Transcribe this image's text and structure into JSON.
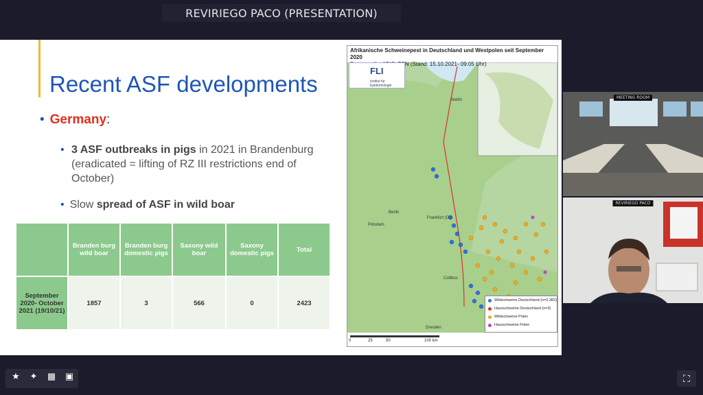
{
  "window": {
    "title": "REVIRIEGO PACO (PRESENTATION)"
  },
  "slide": {
    "title": "Recent ASF developments",
    "bullet1_label": "Germany",
    "bullet1_colon": ":",
    "bullet2_bold": "3 ASF outbreaks in pigs",
    "bullet2_rest": " in 2021 in Brandenburg (eradicated = lifting of RZ III restrictions end of October)",
    "bullet3_pre": "Slow ",
    "bullet3_bold": "spread of ASF in wild boar",
    "table": {
      "headers": [
        "",
        "Branden burg wild boar",
        "Branden burg domestic pigs",
        "Saxony wild boar",
        "Saxony domestic pigs",
        "Total"
      ],
      "row": [
        "September 2020- October 2021 (19/10/21)",
        "1857",
        "3",
        "566",
        "0",
        "2423"
      ]
    },
    "map": {
      "title_line1": "Afrikanische Schweinepest in Deutschland und Westpolen seit September 2020",
      "title_line2": "Datenquelle: ADIS, TSN (Stand: 15.10.2021- 09:05 Uhr)",
      "logo": "FLI",
      "logo_sub": "Institut für Epidemiologie",
      "cities": [
        "Stettin",
        "Berlin",
        "Potsdam",
        "Frankfurt (O.)",
        "Cottbus",
        "Dresden"
      ],
      "legend": [
        {
          "label": "Wildschweine Deutschland (n=2.382)",
          "color": "#2f6fe0"
        },
        {
          "label": "Hausschweine Deutschland (n=3)",
          "color": "#e03020"
        },
        {
          "label": "Wildschweine Polen",
          "color": "#f2a820"
        },
        {
          "label": "Hausschweine Polen",
          "color": "#c040d0"
        }
      ],
      "scale": [
        "0",
        "25",
        "50",
        "100 km"
      ]
    }
  },
  "side": {
    "top_label": "MEETING ROOM",
    "bottom_label": "REVIRIEGO PACO"
  },
  "toolbar": {
    "icons": [
      "pin-icon",
      "pin-outline-icon",
      "grid-icon",
      "screen-icon"
    ],
    "fullscreen": "fullscreen-icon"
  }
}
